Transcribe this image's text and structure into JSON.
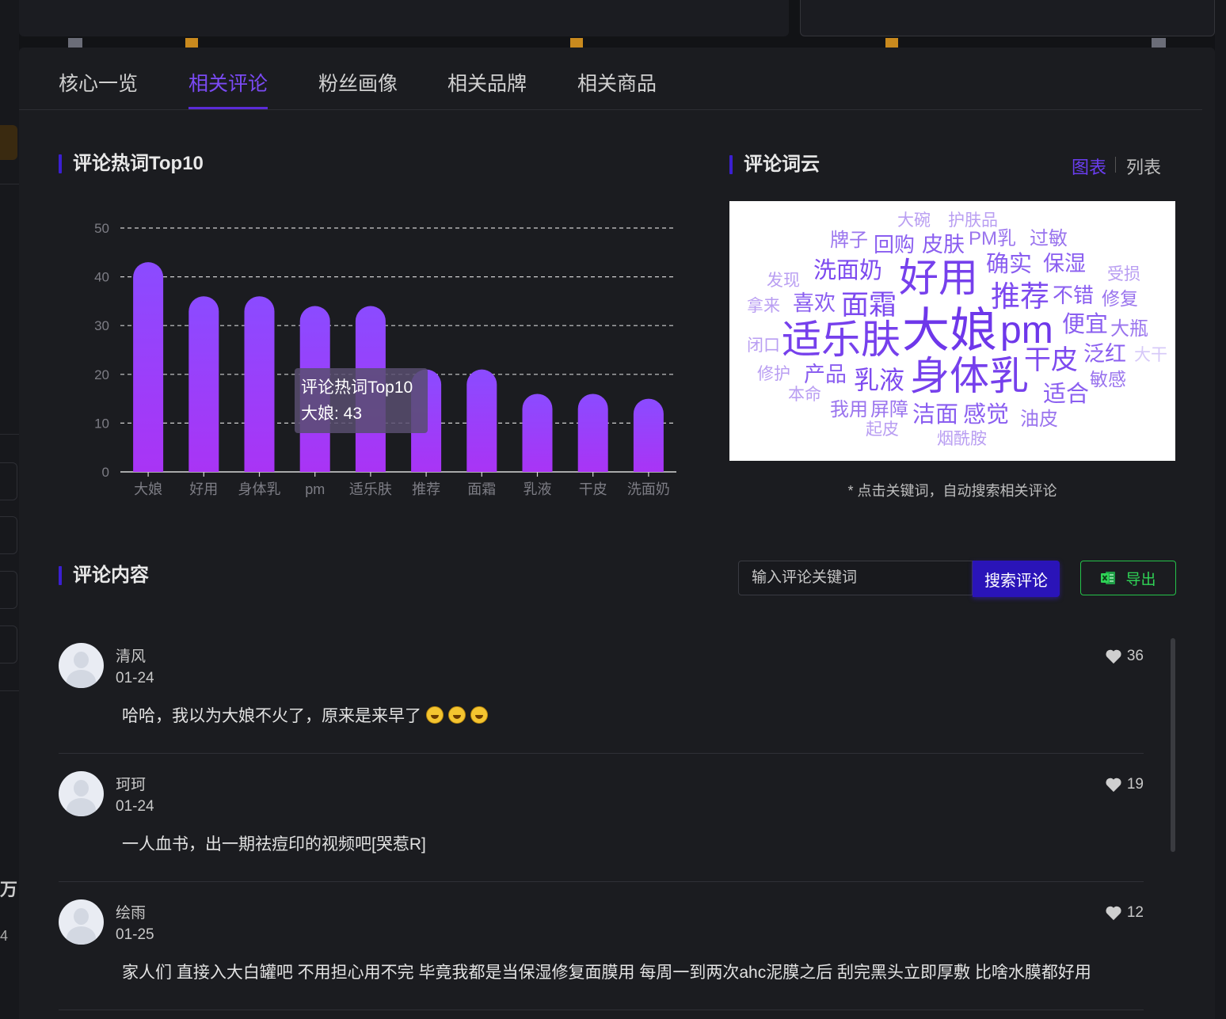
{
  "tabs": [
    {
      "label": "核心一览"
    },
    {
      "label": "相关评论"
    },
    {
      "label": "粉丝画像"
    },
    {
      "label": "相关品牌"
    },
    {
      "label": "相关商品"
    }
  ],
  "hotwords": {
    "title": "评论热词Top10",
    "tooltip": {
      "series": "评论热词Top10",
      "text": "大娘: 43"
    }
  },
  "chart_data": {
    "type": "bar",
    "title": "评论热词Top10",
    "categories": [
      "大娘",
      "好用",
      "身体乳",
      "pm",
      "适乐肤",
      "推荐",
      "面霜",
      "乳液",
      "干皮",
      "洗面奶"
    ],
    "values": [
      43,
      36,
      36,
      34,
      34,
      21,
      21,
      16,
      16,
      15
    ],
    "ylim": [
      0,
      50
    ],
    "yticks": [
      0,
      10,
      20,
      30,
      40,
      50
    ],
    "grid": true,
    "colors": {
      "top": "#8b4bff",
      "bottom": "#a934f5"
    }
  },
  "wordcloud": {
    "title": "评论词云",
    "view_chart": "图表",
    "view_list": "列表",
    "note": "* 点击关键词，自动搜索相关评论",
    "words": [
      {
        "t": "大碗"
      },
      {
        "t": "护肤品"
      },
      {
        "t": "牌子"
      },
      {
        "t": "回购"
      },
      {
        "t": "皮肤"
      },
      {
        "t": "PM乳"
      },
      {
        "t": "过敏"
      },
      {
        "t": "洗面奶"
      },
      {
        "t": "好用"
      },
      {
        "t": "确实"
      },
      {
        "t": "保湿"
      },
      {
        "t": "发现"
      },
      {
        "t": "受损"
      },
      {
        "t": "拿来"
      },
      {
        "t": "喜欢"
      },
      {
        "t": "面霜"
      },
      {
        "t": "推荐"
      },
      {
        "t": "不错"
      },
      {
        "t": "修复"
      },
      {
        "t": "闭口"
      },
      {
        "t": "适乐肤"
      },
      {
        "t": "大娘"
      },
      {
        "t": "pm"
      },
      {
        "t": "便宜"
      },
      {
        "t": "大瓶"
      },
      {
        "t": "泛红"
      },
      {
        "t": "大干"
      },
      {
        "t": "修护"
      },
      {
        "t": "产品"
      },
      {
        "t": "乳液"
      },
      {
        "t": "身体乳"
      },
      {
        "t": "干皮"
      },
      {
        "t": "敏感"
      },
      {
        "t": "本命"
      },
      {
        "t": "适合"
      },
      {
        "t": "我用"
      },
      {
        "t": "屏障"
      },
      {
        "t": "洁面"
      },
      {
        "t": "感觉"
      },
      {
        "t": "油皮"
      },
      {
        "t": "起皮"
      },
      {
        "t": "烟酰胺"
      }
    ]
  },
  "comments_section": {
    "title": "评论内容",
    "search_placeholder": "输入评论关键词",
    "search_button": "搜索评论",
    "export_button": "导出"
  },
  "comments": [
    {
      "name": "清风",
      "date": "01-24",
      "text": "哈哈，我以为大娘不火了，原来是来早了",
      "likes": "36",
      "emoji_count": 3
    },
    {
      "name": "珂珂",
      "date": "01-24",
      "text": "一人血书，出一期祛痘印的视频吧[哭惹R]",
      "likes": "19",
      "emoji_count": 0
    },
    {
      "name": "绘雨",
      "date": "01-25",
      "text": "家人们 直接入大白罐吧 不用担心用不完 毕竟我都是当保湿修复面膜用 每周一到两次ahc泥膜之后 刮完黑头立即厚敷 比啥水膜都好用",
      "likes": "12",
      "emoji_count": 0
    }
  ],
  "background": {
    "left_text_1": "万",
    "left_text_2": "4"
  }
}
